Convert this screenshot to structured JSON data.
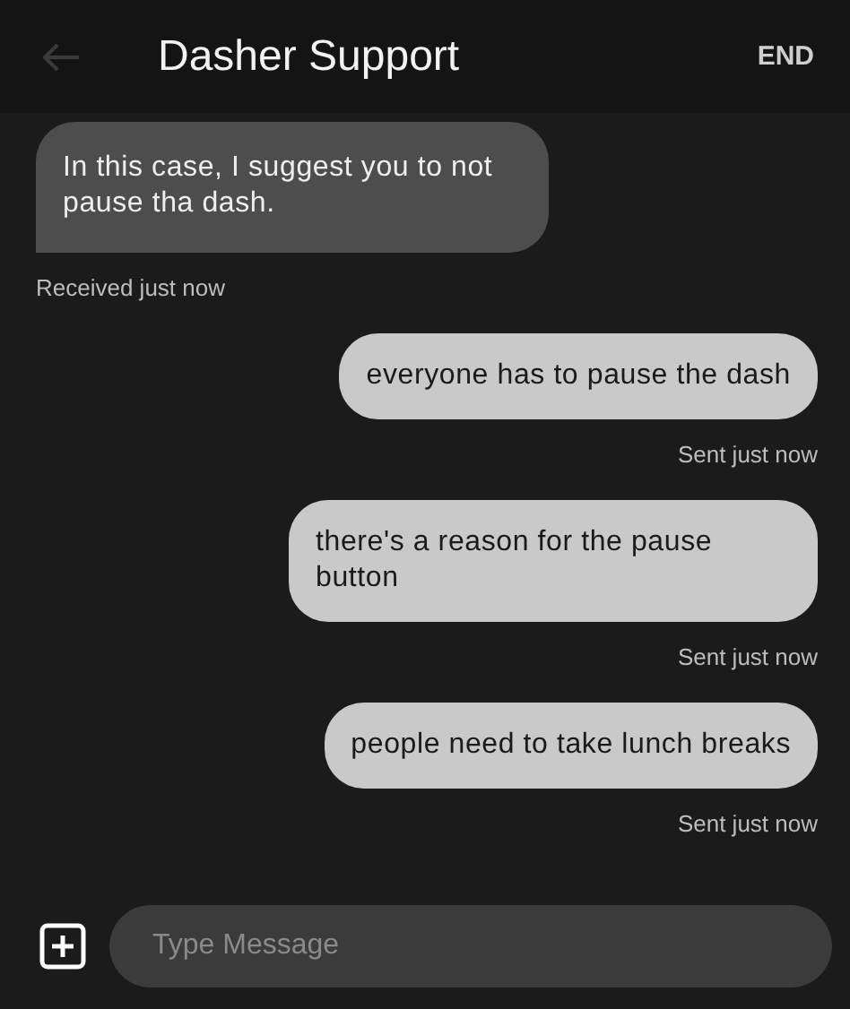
{
  "header": {
    "title": "Dasher Support",
    "action": "END"
  },
  "messages": [
    {
      "kind": "received",
      "text": "In this case, I suggest you to not pause tha dash.",
      "status": "Received just now"
    },
    {
      "kind": "sent",
      "text": "everyone has to pause the dash",
      "status": "Sent just now"
    },
    {
      "kind": "sent",
      "text": "there's a reason for the pause button",
      "status": "Sent just now"
    },
    {
      "kind": "sent",
      "text": "people need to take lunch breaks",
      "status": "Sent just now"
    }
  ],
  "composer": {
    "placeholder": "Type Message"
  }
}
